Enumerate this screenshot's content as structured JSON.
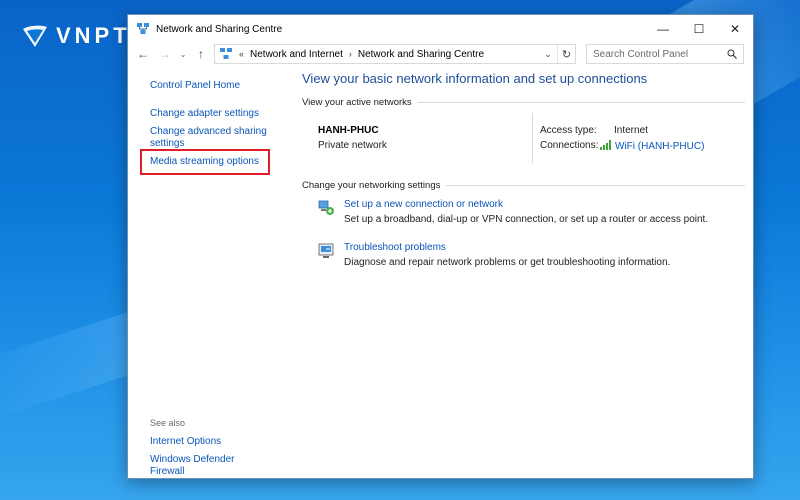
{
  "desktop": {
    "logo_text": "VNPT"
  },
  "window": {
    "title": "Network and Sharing Centre",
    "controls": {
      "minimize": "—",
      "maximize": "☐",
      "close": "✕"
    }
  },
  "addressbar": {
    "prefix": "«",
    "crumbs": [
      "Network and Internet",
      "Network and Sharing Centre"
    ],
    "separator": "›",
    "search_placeholder": "Search Control Panel"
  },
  "sidebar": {
    "items": [
      {
        "label": "Control Panel Home"
      },
      {
        "label": "Change adapter settings"
      },
      {
        "label": "Change advanced sharing settings"
      },
      {
        "label": "Media streaming options"
      }
    ],
    "see_also_title": "See also",
    "see_also": [
      {
        "label": "Internet Options"
      },
      {
        "label": "Windows Defender Firewall"
      }
    ]
  },
  "main": {
    "heading": "View your basic network information and set up connections",
    "active_networks_label": "View your active networks",
    "network": {
      "name": "HANH-PHUC",
      "type": "Private network",
      "access_type_label": "Access type:",
      "access_type_value": "Internet",
      "connections_label": "Connections:",
      "connections_value": "WiFi (HANH-PHUC)"
    },
    "change_settings_label": "Change your networking settings",
    "tasks": [
      {
        "link": "Set up a new connection or network",
        "desc": "Set up a broadband, dial-up or VPN connection, or set up a router or access point."
      },
      {
        "link": "Troubleshoot problems",
        "desc": "Diagnose and repair network problems or get troubleshooting information."
      }
    ]
  },
  "colors": {
    "link": "#0a56b8",
    "heading": "#1e4d9a",
    "highlight": "#e21d2b",
    "desktop": "#0b78d8"
  }
}
